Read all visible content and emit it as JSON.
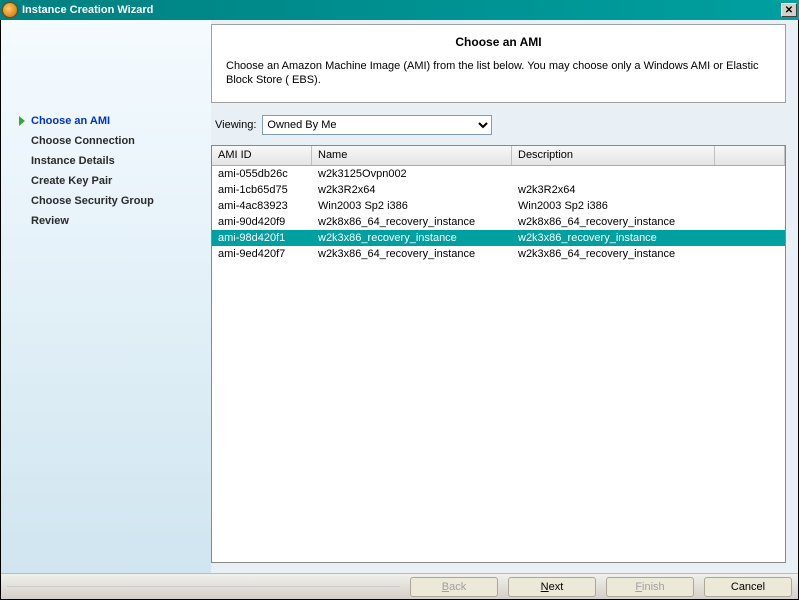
{
  "window": {
    "title": "Instance Creation Wizard"
  },
  "sidebar": {
    "steps": [
      {
        "label": "Choose an AMI",
        "active": true
      },
      {
        "label": "Choose Connection",
        "active": false
      },
      {
        "label": "Instance Details",
        "active": false
      },
      {
        "label": "Create Key Pair",
        "active": false
      },
      {
        "label": "Choose Security Group",
        "active": false
      },
      {
        "label": "Review",
        "active": false
      }
    ]
  },
  "header": {
    "title": "Choose an AMI",
    "description": "Choose an Amazon Machine Image (AMI) from the list below. You may choose only a Windows AMI or Elastic Block Store ( EBS)."
  },
  "viewing": {
    "label": "Viewing:",
    "options": [
      "Owned By Me"
    ],
    "selected": "Owned By Me"
  },
  "table": {
    "headers": {
      "id": "AMI ID",
      "name": "Name",
      "desc": "Description"
    },
    "rows": [
      {
        "id": "ami-055db26c",
        "name": "w2k3125Ovpn002",
        "desc": "",
        "selected": false
      },
      {
        "id": "ami-1cb65d75",
        "name": "w2k3R2x64",
        "desc": "w2k3R2x64",
        "selected": false
      },
      {
        "id": "ami-4ac83923",
        "name": "Win2003 Sp2 i386",
        "desc": "Win2003 Sp2 i386",
        "selected": false
      },
      {
        "id": "ami-90d420f9",
        "name": "w2k8x86_64_recovery_instance",
        "desc": "w2k8x86_64_recovery_instance",
        "selected": false
      },
      {
        "id": "ami-98d420f1",
        "name": "w2k3x86_recovery_instance",
        "desc": "w2k3x86_recovery_instance",
        "selected": true
      },
      {
        "id": "ami-9ed420f7",
        "name": "w2k3x86_64_recovery_instance",
        "desc": "w2k3x86_64_recovery_instance",
        "selected": false
      }
    ]
  },
  "footer": {
    "back": "Back",
    "next": "Next",
    "finish": "Finish",
    "cancel": "Cancel",
    "back_enabled": false,
    "next_enabled": true,
    "finish_enabled": false,
    "cancel_enabled": true
  }
}
